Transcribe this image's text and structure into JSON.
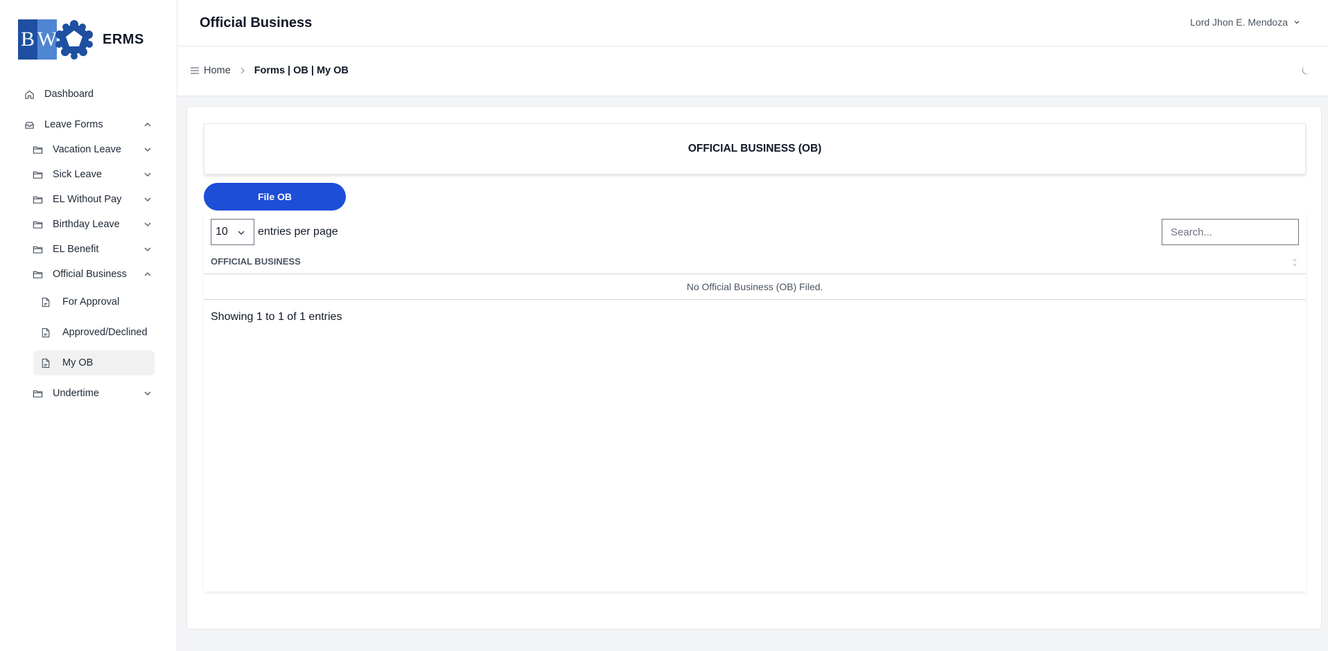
{
  "app": {
    "logo_b": "B",
    "logo_w": "W",
    "name": "ERMS"
  },
  "sidebar": {
    "items": [
      {
        "label": "Dashboard",
        "icon": "home-icon"
      },
      {
        "label": "Leave Forms",
        "icon": "inbox-icon",
        "expanded": true
      },
      {
        "label": "Vacation Leave",
        "icon": "folder-icon"
      },
      {
        "label": "Sick Leave",
        "icon": "folder-icon"
      },
      {
        "label": "EL Without Pay",
        "icon": "folder-icon"
      },
      {
        "label": "Birthday Leave",
        "icon": "folder-icon"
      },
      {
        "label": "EL Benefit",
        "icon": "folder-icon"
      },
      {
        "label": "Official Business",
        "icon": "folder-icon",
        "expanded": true
      },
      {
        "label": "For Approval",
        "icon": "document-icon"
      },
      {
        "label": "Approved/Declined",
        "icon": "document-icon"
      },
      {
        "label": "My OB",
        "icon": "document-icon",
        "active": true
      },
      {
        "label": "Undertime",
        "icon": "folder-icon"
      }
    ]
  },
  "header": {
    "title": "Official Business",
    "user_name": "Lord Jhon E. Mendoza"
  },
  "breadcrumb": {
    "home": "Home",
    "current": "Forms | OB | My OB"
  },
  "main": {
    "card_title": "OFFICIAL BUSINESS (OB)",
    "file_button": "File OB",
    "table": {
      "per_page_value": "10",
      "per_page_label": "entries per page",
      "search_placeholder": "Search...",
      "column_header": "OFFICIAL BUSINESS",
      "empty_message": "No Official Business (OB) Filed.",
      "info": "Showing 1 to 1 of 1 entries"
    }
  },
  "colors": {
    "accent": "#1d4ed8",
    "active_bg": "#f1f1f1"
  }
}
